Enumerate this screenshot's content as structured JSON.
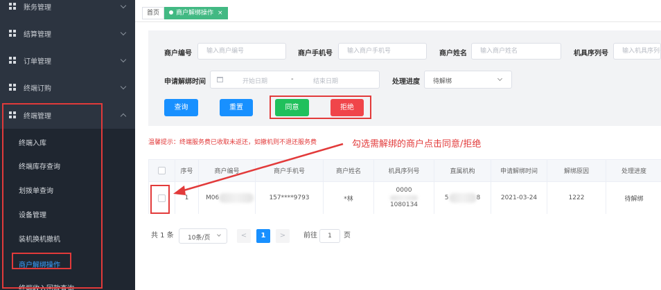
{
  "sidebar": {
    "groups": [
      {
        "label": "账务管理"
      },
      {
        "label": "结算管理"
      },
      {
        "label": "订单管理"
      },
      {
        "label": "终端订购"
      },
      {
        "label": "终端管理"
      }
    ],
    "sub_items": [
      {
        "label": "终端入库"
      },
      {
        "label": "终端库存查询"
      },
      {
        "label": "划拨单查询"
      },
      {
        "label": "设备管理"
      },
      {
        "label": "装机换机撤机"
      },
      {
        "label": "商户解绑操作"
      },
      {
        "label": "终端收入回款查询"
      }
    ]
  },
  "tabs": [
    {
      "label": "首页"
    },
    {
      "label": "商户解绑操作",
      "close": "×"
    }
  ],
  "filters": {
    "merchant_no": {
      "label": "商户编号",
      "placeholder": "输入商户编号"
    },
    "merchant_phone": {
      "label": "商户手机号",
      "placeholder": "输入商户手机号"
    },
    "merchant_name": {
      "label": "商户姓名",
      "placeholder": "输入商户姓名"
    },
    "serial_no": {
      "label": "机具序列号",
      "placeholder": "输入机具序列号"
    },
    "apply_time": {
      "label": "申请解绑时间",
      "start": "开始日期",
      "separator": "-",
      "end": "结束日期"
    },
    "progress": {
      "label": "处理进度",
      "value": "待解绑"
    }
  },
  "buttons": {
    "query": "查询",
    "reset": "重置",
    "agree": "同意",
    "reject": "拒绝"
  },
  "hint": "温馨提示：终端服务费已收取未返还，如撤机则不退还服务费",
  "annotation": "勾选需解绑的商户点击同意/拒绝",
  "table": {
    "headers": [
      "序号",
      "商户编号",
      "商户手机号",
      "商户姓名",
      "机具序列号",
      "直属机构",
      "申请解绑时间",
      "解绑原因",
      "处理进度"
    ],
    "rows": [
      {
        "index": "1",
        "merchant_no_prefix": "M06",
        "phone": "157****9793",
        "name": "*林",
        "serial_line1": "0000",
        "serial_line2": "1080134",
        "org_prefix": "5",
        "org_suffix": "8",
        "apply_time": "2021-03-24",
        "reason": "1222",
        "progress": "待解绑"
      }
    ]
  },
  "pagination": {
    "total": "共 1 条",
    "page_size": "10条/页",
    "prev": "<",
    "current": "1",
    "next": ">",
    "goto_prefix": "前往",
    "goto_value": "1",
    "goto_suffix": "页"
  },
  "colors": {
    "accent": "#1890ff",
    "agree": "#20c05c",
    "reject": "#f0454a",
    "annotation": "#e23a3a",
    "sidebar": "#2c3440"
  }
}
